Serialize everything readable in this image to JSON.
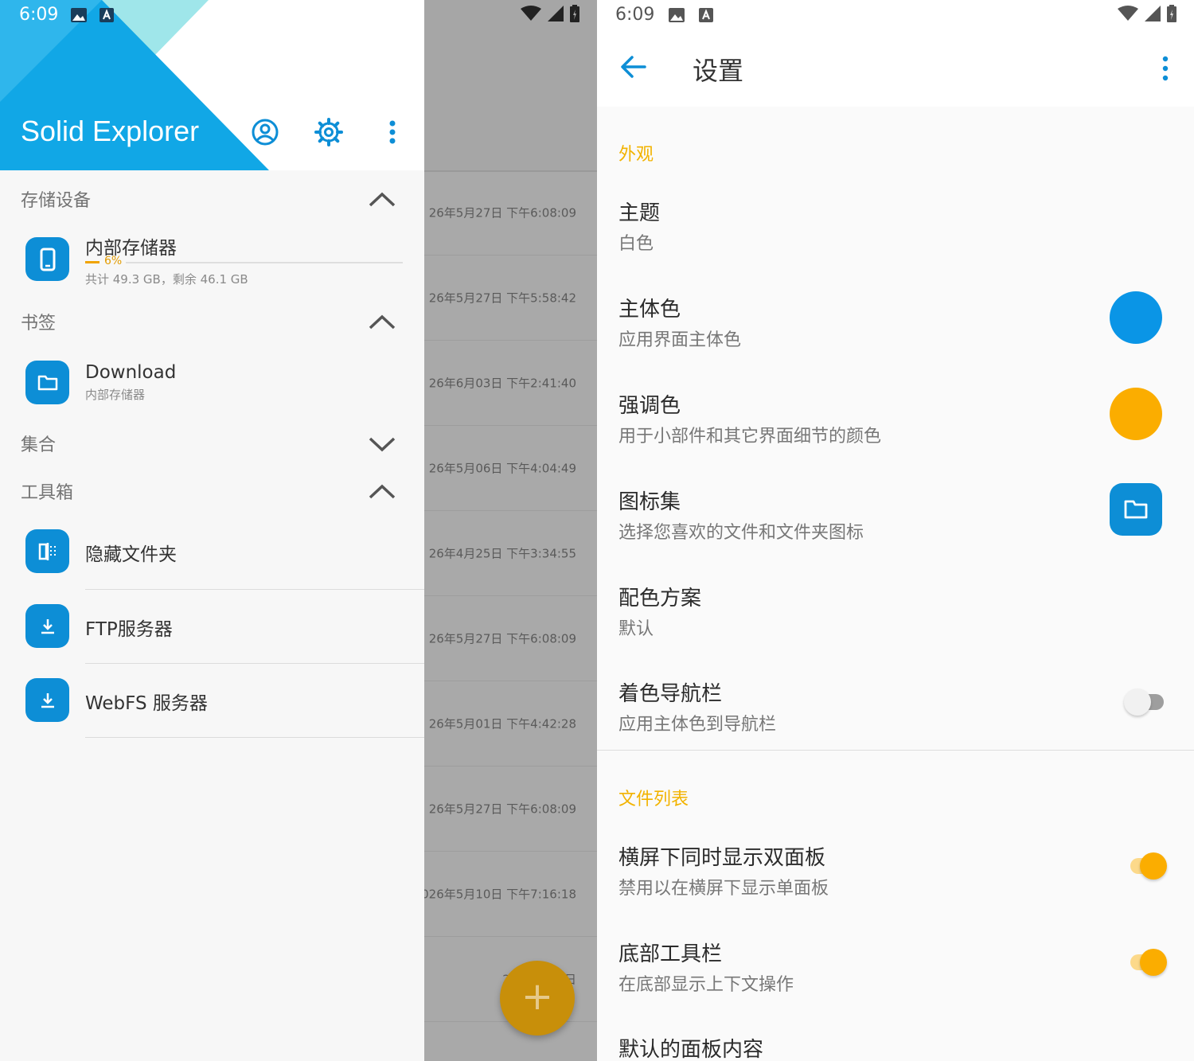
{
  "left": {
    "status": {
      "time": "6:09"
    },
    "app_title": "Solid Explorer",
    "sections": {
      "storage": {
        "label": "存储设备"
      },
      "bookmarks": {
        "label": "书签"
      },
      "collections": {
        "label": "集合"
      },
      "toolbox": {
        "label": "工具箱"
      }
    },
    "storage_item": {
      "title": "内部存储器",
      "percent_label": "6%",
      "usage_fraction": 0.06,
      "details": "共计 49.3 GB，剩余 46.1 GB"
    },
    "bookmark_item": {
      "title": "Download",
      "subtitle": "内部存储器"
    },
    "tools": [
      {
        "label": "隐藏文件夹"
      },
      {
        "label": "FTP服务器"
      },
      {
        "label": "WebFS 服务器"
      }
    ],
    "background_timestamps": [
      "26年5月27日 下午6:08:09",
      "26年5月27日 下午5:58:42",
      "26年6月03日 下午2:41:40",
      "26年5月06日 下午4:04:49",
      "26年4月25日 下午3:34:55",
      "26年5月27日 下午6:08:09",
      "26年5月01日 下午4:42:28",
      "26年5月27日 下午6:08:09",
      "026年5月10日 下午7:16:18",
      "26年5月01日"
    ],
    "fab_symbol": "+",
    "colors": {
      "primary": "#0d8ed6",
      "header_cyan": "#11a7e6",
      "header_light": "#9fe6ea",
      "progress": "#f0a400"
    }
  },
  "right": {
    "status": {
      "time": "6:09"
    },
    "title": "设置",
    "appearance": {
      "category": "外观",
      "theme": {
        "title": "主题",
        "summary": "白色"
      },
      "primary_color": {
        "title": "主体色",
        "summary": "应用界面主体色",
        "swatch": "#0a95e6"
      },
      "accent_color": {
        "title": "强调色",
        "summary": "用于小部件和其它界面细节的颜色",
        "swatch": "#fbad00"
      },
      "icon_set": {
        "title": "图标集",
        "summary": "选择您喜欢的文件和文件夹图标"
      },
      "color_scheme": {
        "title": "配色方案",
        "summary": "默认"
      },
      "tint_navbar": {
        "title": "着色导航栏",
        "summary": "应用主体色到导航栏",
        "enabled": false
      }
    },
    "file_list": {
      "category": "文件列表",
      "dual_pane": {
        "title": "横屏下同时显示双面板",
        "summary": "禁用以在横屏下显示单面板",
        "enabled": true
      },
      "bottom_toolbar": {
        "title": "底部工具栏",
        "summary": "在底部显示上下文操作",
        "enabled": true
      },
      "default_pane": {
        "title": "默认的面板内容"
      }
    }
  }
}
